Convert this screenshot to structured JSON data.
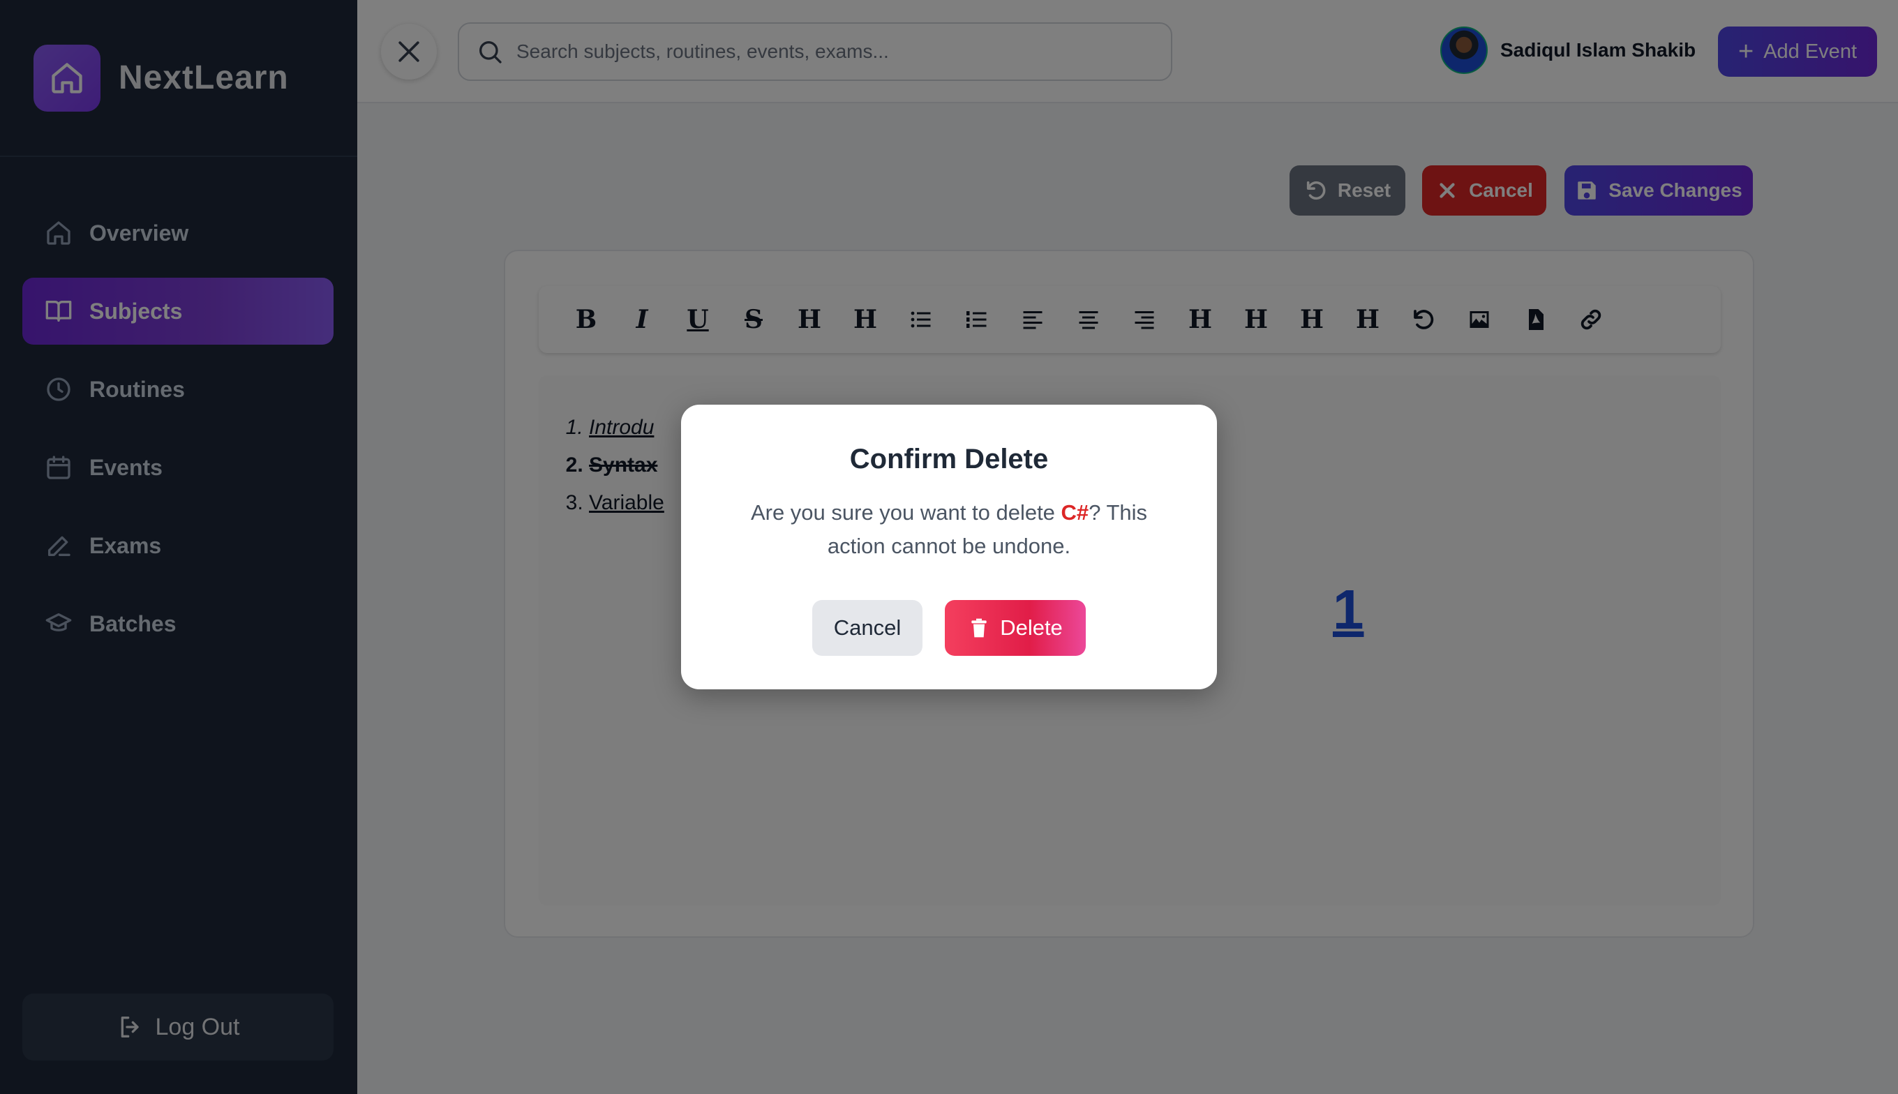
{
  "app": {
    "name": "NextLearn"
  },
  "sidebar": {
    "items": [
      {
        "label": "Overview",
        "icon": "home-icon",
        "active": false
      },
      {
        "label": "Subjects",
        "icon": "book-icon",
        "active": true
      },
      {
        "label": "Routines",
        "icon": "clock-icon",
        "active": false
      },
      {
        "label": "Events",
        "icon": "calendar-icon",
        "active": false
      },
      {
        "label": "Exams",
        "icon": "pencil-icon",
        "active": false
      },
      {
        "label": "Batches",
        "icon": "graduation-cap-icon",
        "active": false
      }
    ],
    "logout_label": "Log Out"
  },
  "topbar": {
    "search_placeholder": "Search subjects, routines, events, exams...",
    "user_name": "Sadiqul Islam Shakib",
    "add_event_label": "Add Event"
  },
  "actions": {
    "reset_label": "Reset",
    "cancel_label": "Cancel",
    "save_label": "Save Changes"
  },
  "editor": {
    "list_items": [
      "Introdu",
      "Syntax",
      "Variable"
    ],
    "heading_fragment": "1"
  },
  "modal": {
    "title": "Confirm Delete",
    "message_prefix": "Are you sure you want to delete ",
    "subject": "C#",
    "message_suffix": "? This action cannot be undone.",
    "cancel_label": "Cancel",
    "delete_label": "Delete"
  },
  "colors": {
    "sidebar_bg": "#1e293b",
    "accent": "#6d28d9",
    "danger": "#dc2626"
  }
}
